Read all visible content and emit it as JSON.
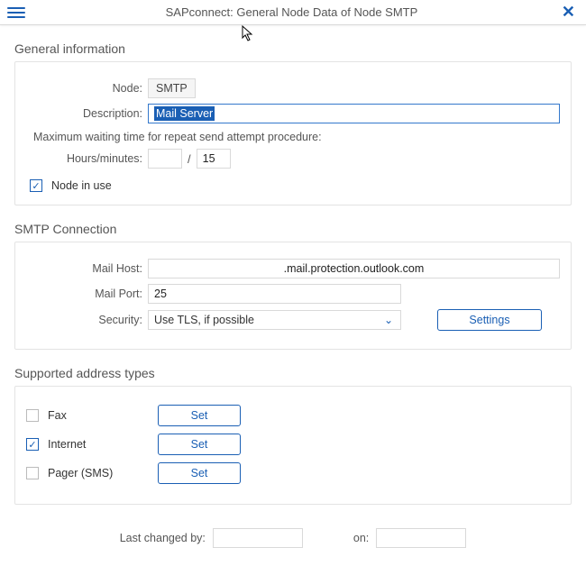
{
  "header": {
    "title": "SAPconnect: General Node Data of Node SMTP"
  },
  "general": {
    "title": "General information",
    "node_label": "Node:",
    "node_value": "SMTP",
    "desc_label": "Description:",
    "desc_value": "Mail Server",
    "waiting_text": "Maximum waiting time for repeat send attempt procedure:",
    "hm_label": "Hours/minutes:",
    "hours_value": "",
    "minutes_value": "15",
    "in_use_label": "Node in use",
    "in_use_checked": true
  },
  "smtp": {
    "title": "SMTP Connection",
    "host_label": "Mail Host:",
    "host_value": ".mail.protection.outlook.com",
    "port_label": "Mail Port:",
    "port_value": "25",
    "security_label": "Security:",
    "security_value": "Use TLS, if possible",
    "settings_label": "Settings"
  },
  "addr": {
    "title": "Supported address types",
    "set_label": "Set",
    "items": [
      {
        "label": "Fax",
        "checked": false
      },
      {
        "label": "Internet",
        "checked": true
      },
      {
        "label": "Pager (SMS)",
        "checked": false
      }
    ]
  },
  "footer": {
    "changed_by_label": "Last changed by:",
    "changed_by_value": "",
    "on_label": "on:",
    "on_value": ""
  }
}
